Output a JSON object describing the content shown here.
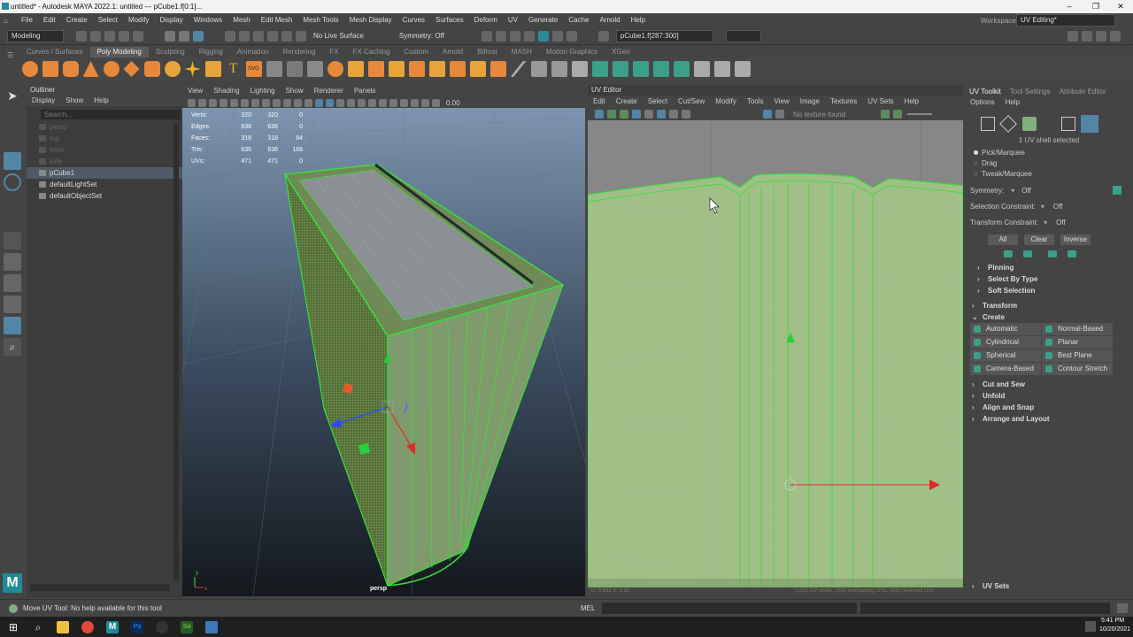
{
  "window": {
    "title": "untitled* - Autodesk MAYA 2022.1: untitled  ---  pCube1.f[0:1]..."
  },
  "menubar": [
    "File",
    "Edit",
    "Create",
    "Select",
    "Modify",
    "Display",
    "Windows",
    "Mesh",
    "Edit Mesh",
    "Mesh Tools",
    "Mesh Display",
    "Curves",
    "Surfaces",
    "Deform",
    "UV",
    "Generate",
    "Cache",
    "Arnold",
    "Help"
  ],
  "workspace": {
    "label": "Workspace:",
    "value": "UV Editing*"
  },
  "statusline": {
    "mode": "Modeling",
    "live_surface": "No Live Surface",
    "symmetry": "Symmetry: Off",
    "selection_field": "pCube1.f[287:300]"
  },
  "shelf_tabs": [
    "Curves / Surfaces",
    "Poly Modeling",
    "Sculpting",
    "Rigging",
    "Animation",
    "Rendering",
    "FX",
    "FX Caching",
    "Custom",
    "Arnold",
    "Bifrost",
    "MASH",
    "Motion Graphics",
    "XGen"
  ],
  "shelf_active": "Poly Modeling",
  "outliner": {
    "title": "Outliner",
    "menu": [
      "Display",
      "Show",
      "Help"
    ],
    "search_placeholder": "Search...",
    "items": [
      {
        "label": "persp",
        "dim": true
      },
      {
        "label": "top",
        "dim": true
      },
      {
        "label": "front",
        "dim": true
      },
      {
        "label": "side",
        "dim": true
      },
      {
        "label": "pCube1",
        "dim": false,
        "selected": true
      },
      {
        "label": "defaultLightSet",
        "dim": false
      },
      {
        "label": "defaultObjectSet",
        "dim": false
      }
    ]
  },
  "viewport": {
    "menu": [
      "View",
      "Shading",
      "Lighting",
      "Show",
      "Renderer",
      "Panels"
    ],
    "camera": "persp",
    "exposure": "0.00",
    "hud": [
      {
        "label": "Verts:",
        "a": "320",
        "b": "320",
        "c": "0"
      },
      {
        "label": "Edges:",
        "a": "636",
        "b": "636",
        "c": "0"
      },
      {
        "label": "Faces:",
        "a": "318",
        "b": "318",
        "c": "84"
      },
      {
        "label": "Tris:",
        "a": "636",
        "b": "636",
        "c": "168"
      },
      {
        "label": "UVs:",
        "a": "471",
        "b": "471",
        "c": "0"
      }
    ],
    "axis": {
      "y": "y",
      "x": "x"
    }
  },
  "uv_editor": {
    "title": "UV Editor",
    "menu": [
      "Edit",
      "Create",
      "Select",
      "Cut/Sew",
      "Modify",
      "Tools",
      "View",
      "Image",
      "Textures",
      "UV Sets",
      "Help"
    ],
    "texture": "No texture found",
    "coords": "U: 0.392  V: 1.20",
    "footer": "(1/11) UV shells, (0/0) overlapping UVs, (0/0) reversed UVs"
  },
  "uv_toolkit": {
    "tabs": [
      "UV Toolkit",
      "Tool Settings",
      "Attribute Editor"
    ],
    "menu": [
      "Options",
      "Help"
    ],
    "shell_status": "1 UV shell selected",
    "modes": [
      "Pick/Marquee",
      "Drag",
      "Tweak/Marquee"
    ],
    "symmetry": {
      "label": "Symmetry:",
      "value": "Off"
    },
    "selection_constraint": {
      "label": "Selection Constraint:",
      "value": "Off"
    },
    "transform_constraint": {
      "label": "Transform Constraint:",
      "value": "Off"
    },
    "buttons": [
      "All",
      "Clear",
      "Inverse"
    ],
    "subsections": [
      "Pinning",
      "Select By Type",
      "Soft Selection"
    ],
    "sections_top": [
      "Transform",
      "Create"
    ],
    "create_buttons": [
      "Automatic",
      "Normal-Based",
      "Cylindrical",
      "Planar",
      "Spherical",
      "Best Plane",
      "Camera-Based",
      "Contour Stretch"
    ],
    "sections_bottom": [
      "Cut and Sew",
      "Unfold",
      "Align and Snap",
      "Arrange and Layout"
    ],
    "uv_sets": "UV Sets"
  },
  "help_line": "Move UV Tool: No help available for this tool",
  "mel": "MEL",
  "clock": {
    "time": "5:41 PM",
    "date": "10/20/2021"
  },
  "colors": {
    "accent": "#5285a6",
    "green": "#39e03a",
    "uvfill": "#a4bf8d"
  }
}
